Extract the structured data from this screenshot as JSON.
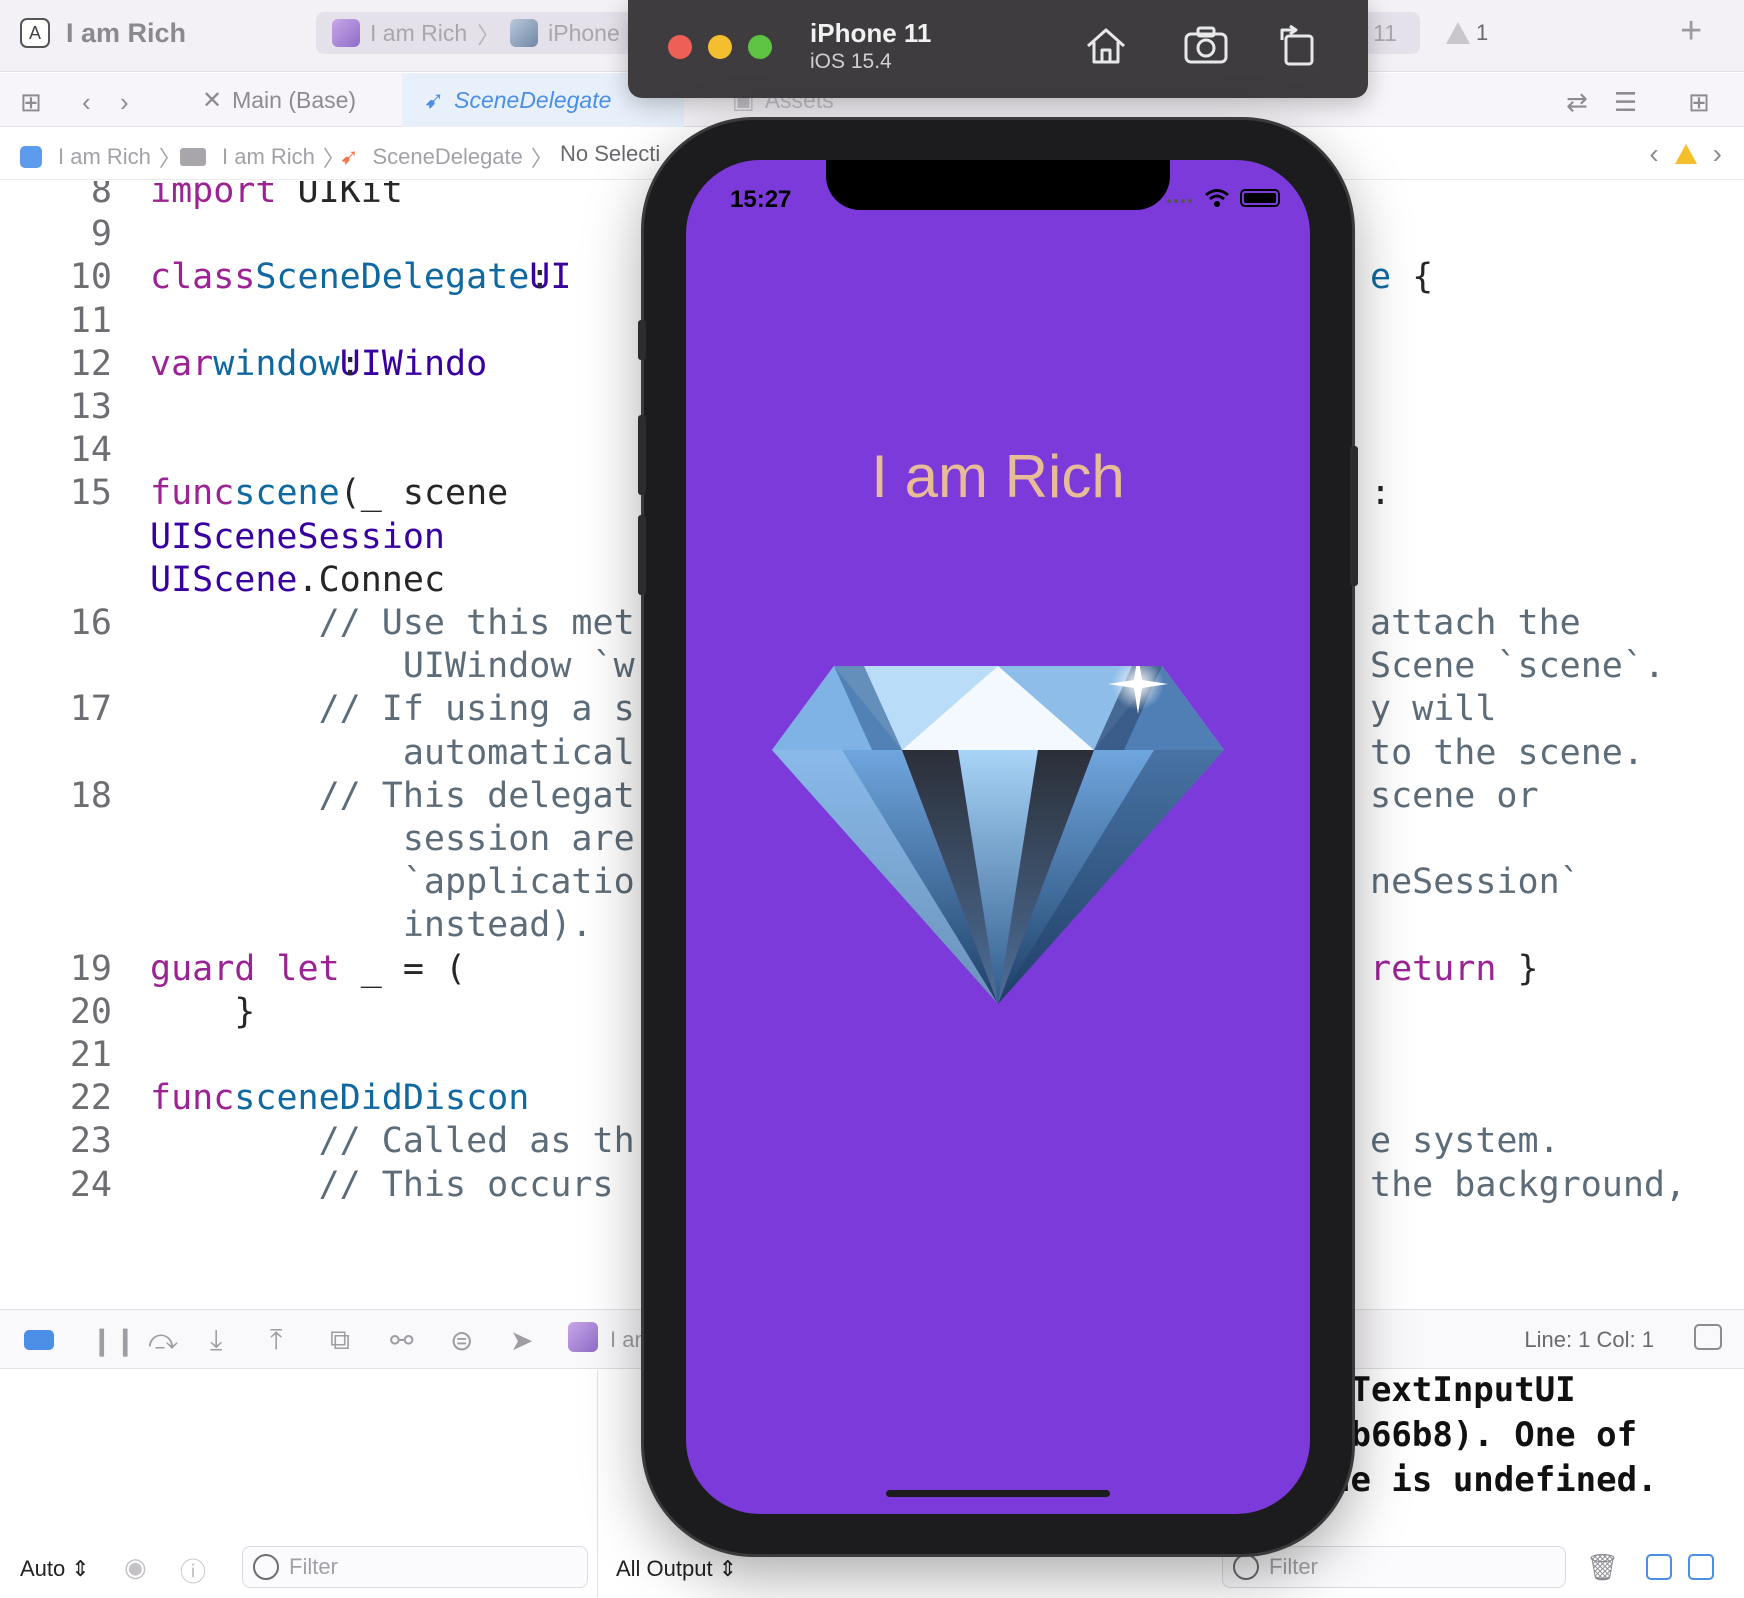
{
  "titlebar": {
    "project": "I am Rich",
    "scheme_target": "I am Rich",
    "scheme_device": "iPhone 1",
    "right_pill": "11",
    "warnings": "1"
  },
  "tabs": [
    {
      "label": "Main (Base)"
    },
    {
      "label": "SceneDelegate"
    },
    {
      "label": "Assets"
    }
  ],
  "jumpbar": {
    "project": "I am Rich",
    "group": "I am Rich",
    "file": "SceneDelegate",
    "selection": "No Selecti"
  },
  "code": {
    "lines": [
      {
        "n": "8",
        "parts": [
          [
            "kw",
            "import"
          ],
          [
            "cd",
            " UIKit"
          ]
        ]
      },
      {
        "n": "9",
        "parts": []
      },
      {
        "n": "10",
        "parts": [
          [
            "kw",
            "class"
          ],
          [
            "cd",
            " "
          ],
          [
            "fn",
            "SceneDelegate"
          ],
          [
            "cd",
            ": "
          ],
          [
            "ty",
            "UI"
          ]
        ],
        "right": [
          [
            "fn",
            "e"
          ],
          [
            "cd",
            " {"
          ]
        ]
      },
      {
        "n": "11",
        "parts": []
      },
      {
        "n": "12",
        "parts": [
          [
            "cd",
            "    "
          ],
          [
            "kw",
            "var"
          ],
          [
            "cd",
            " "
          ],
          [
            "fn",
            "window"
          ],
          [
            "cd",
            ": "
          ],
          [
            "ty",
            "UIWindo"
          ]
        ]
      },
      {
        "n": "13",
        "parts": []
      },
      {
        "n": "14",
        "parts": []
      },
      {
        "n": "15",
        "parts": [
          [
            "cd",
            "    "
          ],
          [
            "kw",
            "func"
          ],
          [
            "cd",
            " "
          ],
          [
            "fn",
            "scene"
          ],
          [
            "cd",
            "(_ scene"
          ]
        ],
        "right": [
          [
            "cd",
            ":"
          ]
        ]
      },
      {
        "n": "",
        "parts": [
          [
            "cd",
            "        "
          ],
          [
            "ty",
            "UISceneSession"
          ]
        ]
      },
      {
        "n": "",
        "parts": [
          [
            "cd",
            "        "
          ],
          [
            "ty",
            "UIScene"
          ],
          [
            "cd",
            ".Connec"
          ]
        ]
      },
      {
        "n": "16",
        "parts": [
          [
            "cm",
            "        // Use this met"
          ]
        ],
        "right": [
          [
            "cm",
            "attach the"
          ]
        ]
      },
      {
        "n": "",
        "parts": [
          [
            "cm",
            "            UIWindow `w"
          ]
        ],
        "right": [
          [
            "cm",
            "Scene `scene`."
          ]
        ]
      },
      {
        "n": "17",
        "parts": [
          [
            "cm",
            "        // If using a s"
          ]
        ],
        "right": [
          [
            "cm",
            "y will"
          ]
        ]
      },
      {
        "n": "",
        "parts": [
          [
            "cm",
            "            automatical"
          ]
        ],
        "right": [
          [
            "cm",
            "to the scene."
          ]
        ]
      },
      {
        "n": "18",
        "parts": [
          [
            "cm",
            "        // This delegat"
          ]
        ],
        "right": [
          [
            "cm",
            "scene or"
          ]
        ]
      },
      {
        "n": "",
        "parts": [
          [
            "cm",
            "            session are"
          ]
        ]
      },
      {
        "n": "",
        "parts": [
          [
            "cm",
            "            `applicatio"
          ]
        ],
        "right": [
          [
            "cm",
            "neSession`"
          ]
        ]
      },
      {
        "n": "",
        "parts": [
          [
            "cm",
            "            instead)."
          ]
        ]
      },
      {
        "n": "19",
        "parts": [
          [
            "cd",
            "        "
          ],
          [
            "kw",
            "guard let"
          ],
          [
            "cd",
            " _ = ("
          ]
        ],
        "right": [
          [
            "kw",
            "return"
          ],
          [
            "cd",
            " }"
          ]
        ]
      },
      {
        "n": "20",
        "parts": [
          [
            "cd",
            "    }"
          ]
        ]
      },
      {
        "n": "21",
        "parts": []
      },
      {
        "n": "22",
        "parts": [
          [
            "cd",
            "    "
          ],
          [
            "kw",
            "func"
          ],
          [
            "cd",
            " "
          ],
          [
            "fn",
            "sceneDidDiscon"
          ]
        ]
      },
      {
        "n": "23",
        "parts": [
          [
            "cm",
            "        // Called as th"
          ]
        ],
        "right": [
          [
            "cm",
            "e system."
          ]
        ]
      },
      {
        "n": "24",
        "parts": [
          [
            "cm",
            "        // This occurs"
          ]
        ],
        "right": [
          [
            "cm",
            "the background,"
          ]
        ]
      }
    ]
  },
  "debug": {
    "line_col": "Line: 1  Col: 1",
    "target_label": "I am"
  },
  "console": {
    "lines": [
      "/TextInputUI",
      "0b66b8). One of",
      "ne is undefined."
    ],
    "scope_left": "Auto",
    "scope_right": "All Output",
    "filter_left": "Filter",
    "filter_right": "Filter"
  },
  "simulator": {
    "device": "iPhone 11",
    "os": "iOS 15.4",
    "status_time": "15:27",
    "app_title": "I am Rich",
    "screen_color": "#7d3adb",
    "title_color": "#e6bd97",
    "image": "diamond"
  }
}
